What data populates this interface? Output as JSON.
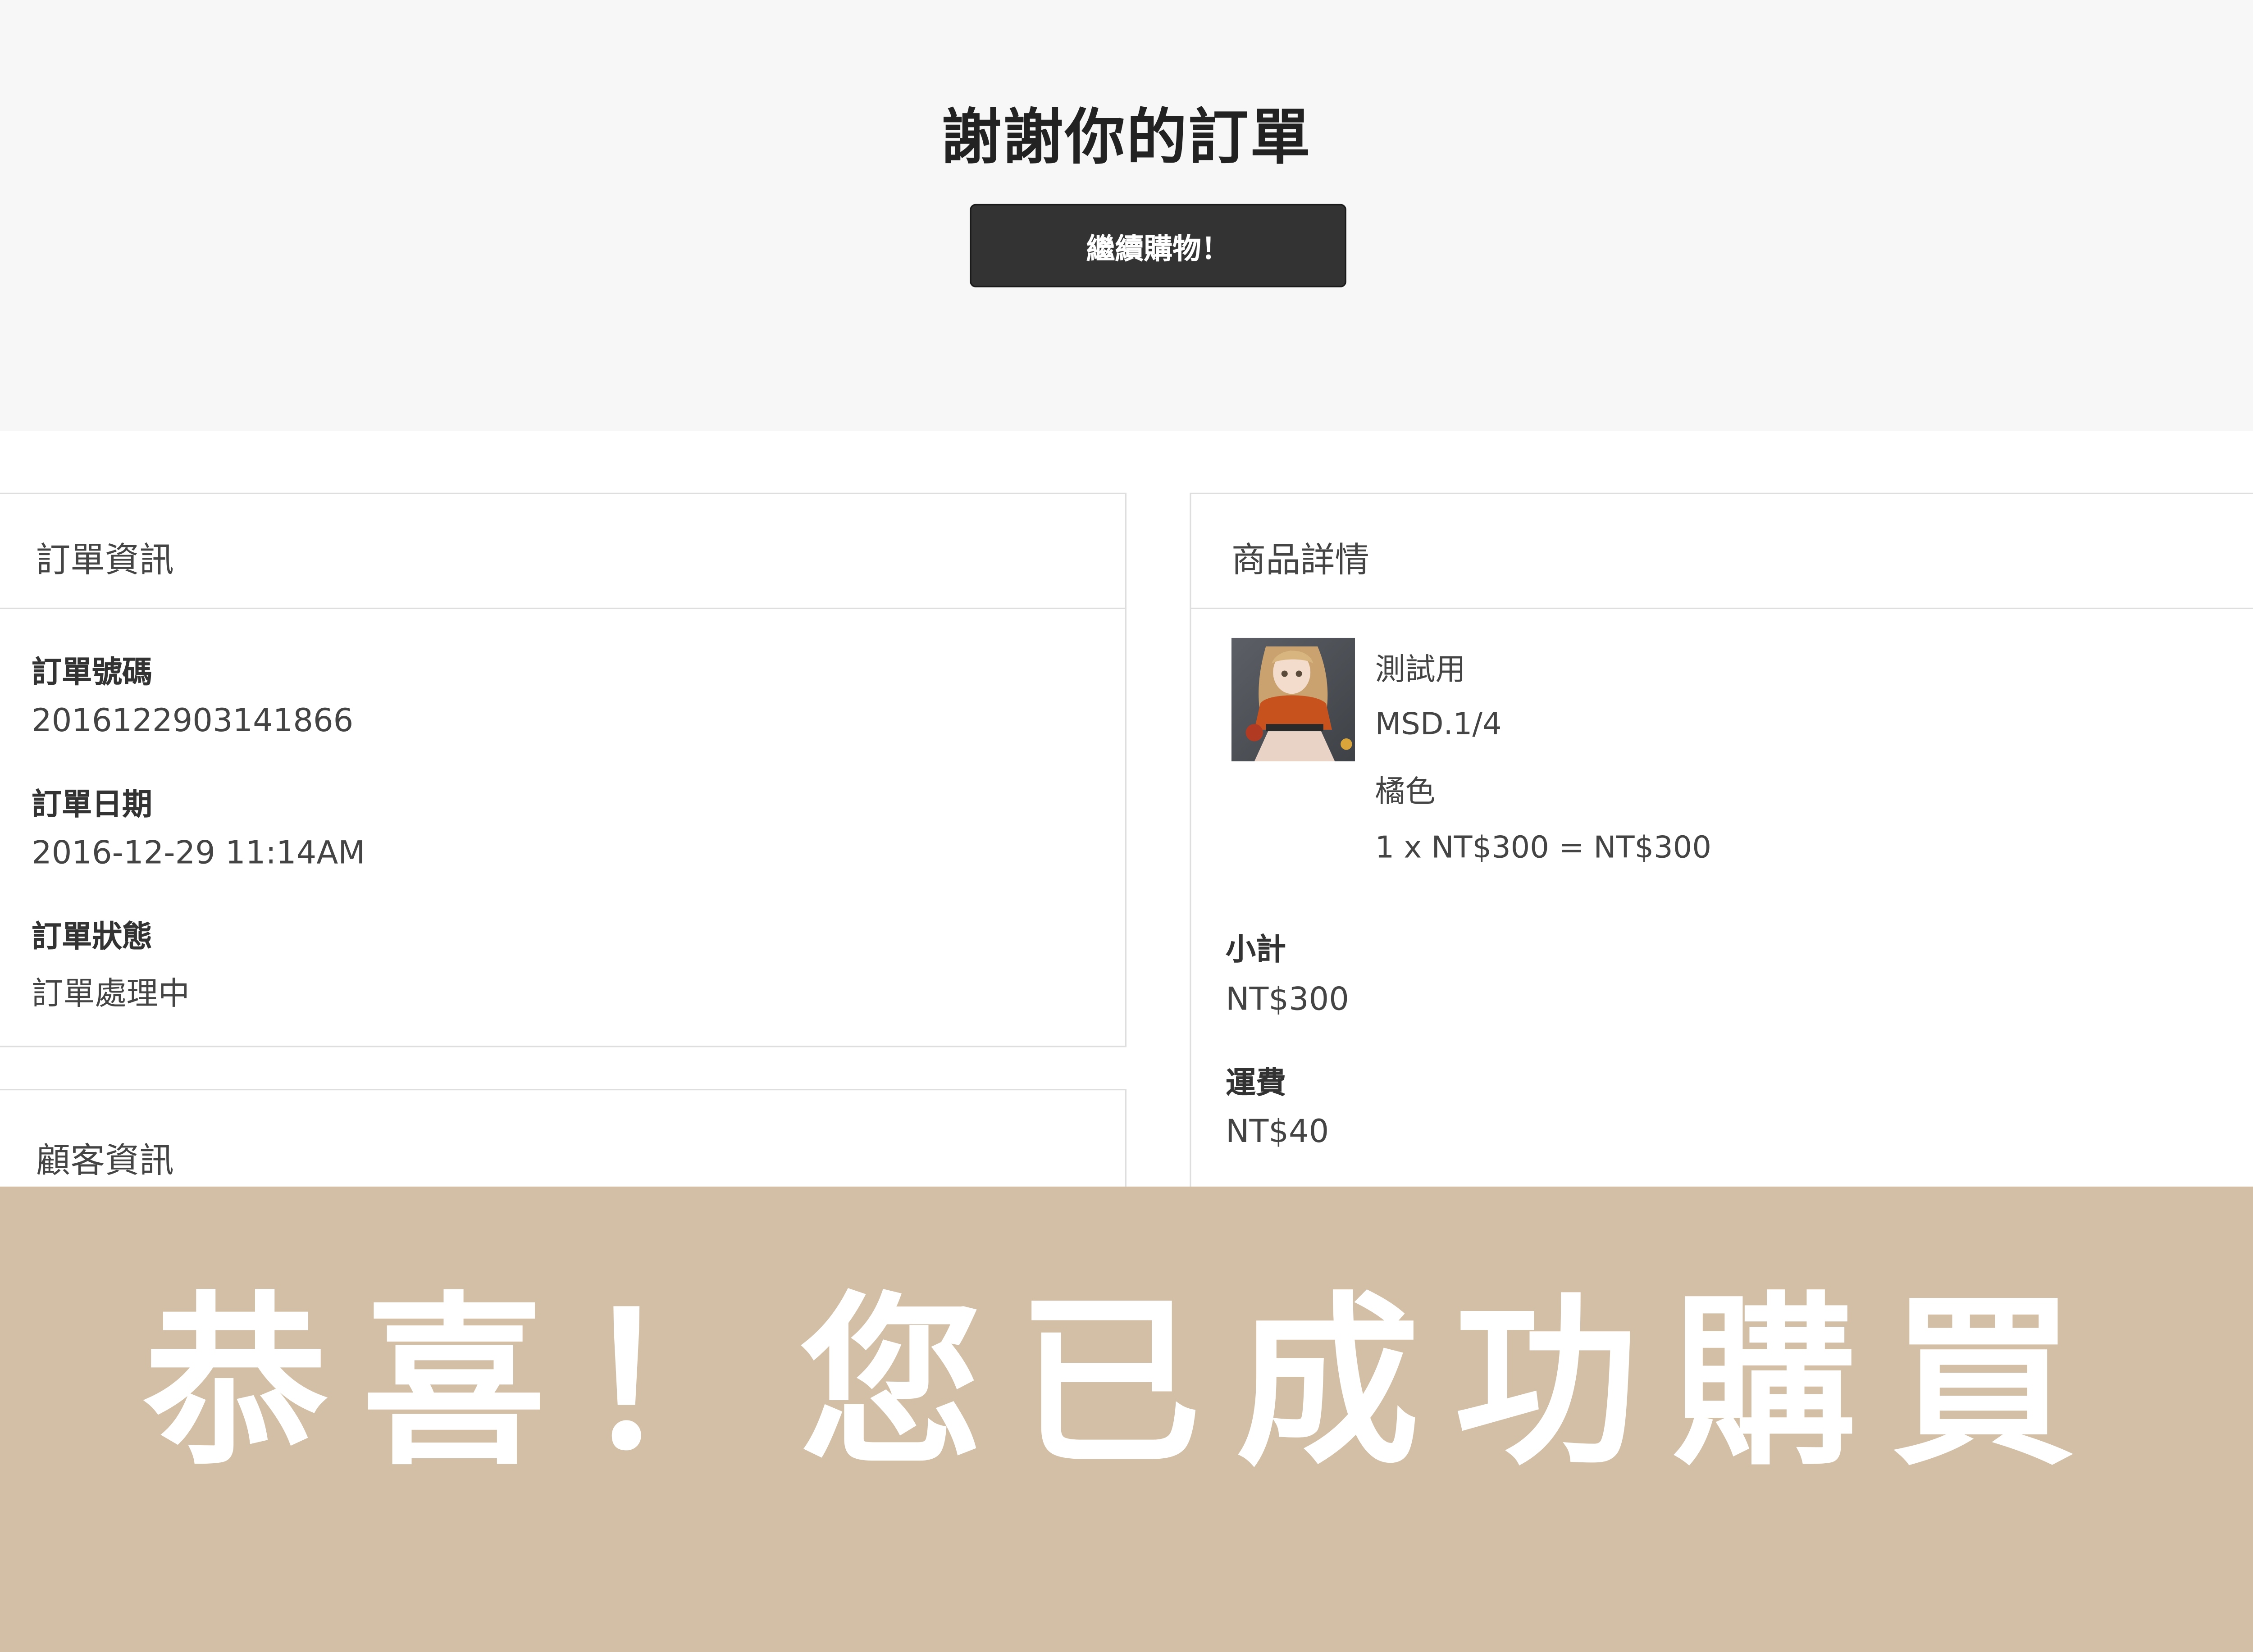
{
  "hero": {
    "title": "謝謝你的訂單",
    "continue_button": "繼續購物！"
  },
  "order_info": {
    "heading": "訂單資訊",
    "fields": [
      {
        "label": "訂單號碼",
        "value": "2016122903141866"
      },
      {
        "label": "訂單日期",
        "value": "2016-12-29 11:14AM"
      },
      {
        "label": "訂單狀態",
        "value": "訂單處理中"
      }
    ]
  },
  "customer_info": {
    "heading": "顧客資訊"
  },
  "product_details": {
    "heading": "商品詳情",
    "item": {
      "name": "測試用",
      "variant_size": "MSD.1/4",
      "variant_color": "橘色",
      "price_line": "1 x NT$300 = NT$300"
    },
    "subtotal": {
      "label": "小計",
      "value": "NT$300"
    },
    "shipping": {
      "label": "運費",
      "value": "NT$40"
    }
  },
  "banner": {
    "text": "恭喜！您已成功購買"
  },
  "colors": {
    "hero_background": "#f7f7f7",
    "button_background": "#333333",
    "banner_background": "#d2bfa5",
    "banner_text": "#ffffff",
    "border": "#dedede"
  },
  "icons": {
    "product_thumbnail": "doll-photo"
  }
}
